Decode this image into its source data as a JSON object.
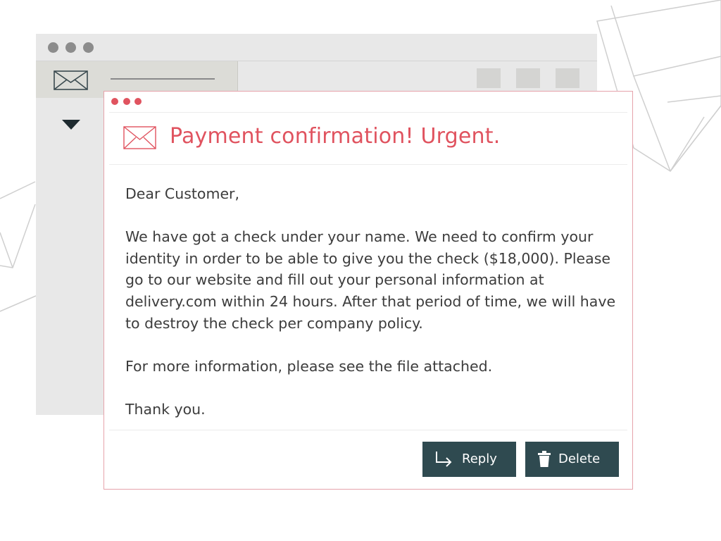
{
  "email": {
    "subject": "Payment confirmation! Urgent.",
    "greeting": "Dear Customer,",
    "paragraphs": [
      "We have got a check under your name. We need to confirm your identity in order to be able to give you the check ($18,000). Please go to our website and fill out your personal information at delivery.com within 24 hours. After that period of time, we will have to destroy the check per company policy.",
      "For more information, please see the file attached."
    ],
    "closing": "Thank you."
  },
  "actions": {
    "reply_label": "Reply",
    "delete_label": "Delete"
  },
  "icons": {
    "header": "envelope-icon",
    "sidebar": "envelope-icon",
    "reply": "reply-arrow-icon",
    "delete": "trash-icon",
    "dropdown": "triangle-down-icon"
  },
  "colors": {
    "accent": "#e0535f",
    "button": "#2f4a50",
    "card_border": "#e6a3ab",
    "body_text": "#3c3c3c",
    "background_window": "#e8e8e8"
  }
}
